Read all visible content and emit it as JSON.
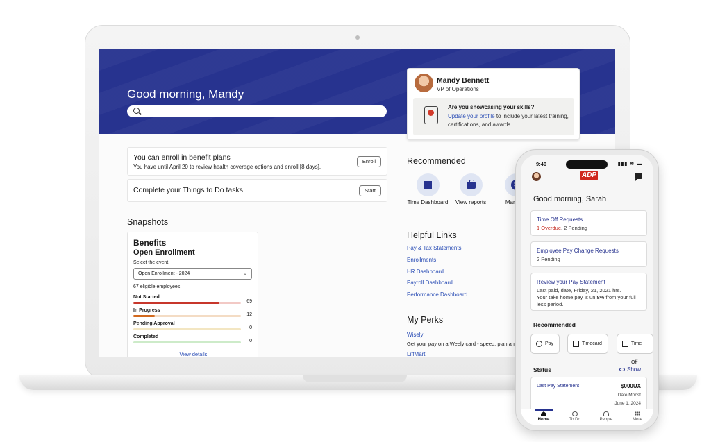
{
  "desktop": {
    "greeting": "Good morning, Mandy",
    "search": {
      "placeholder": ""
    },
    "profile": {
      "name": "Mandy Bennett",
      "title": "VP of Operations",
      "skills_question": "Are you showcasing your skills?",
      "skills_link": "Update your profile",
      "skills_text": " to include your latest training, certifications, and awards."
    },
    "enroll": {
      "title": "You can enroll in benefit plans",
      "subtitle": "You have until April 20 to review health coverage options and enroll [8 days].",
      "button": "Enroll"
    },
    "todo": {
      "title": "Complete your Things to Do tasks",
      "button": "Start"
    },
    "snapshots": {
      "heading": "Snapshots",
      "benefits": {
        "title": "Benefits",
        "subtitle": "Open Enrollment",
        "select_label": "Select the event.",
        "select_value": "Open Enrollment - 2024",
        "eligible": "67 eligible employees",
        "rows": [
          {
            "label": "Not Started",
            "count": "69",
            "fraction": 0.8,
            "color": "#c7362b",
            "track": "#f2c9c5"
          },
          {
            "label": "In Progress",
            "count": "12",
            "fraction": 0.2,
            "color": "#d2691e",
            "track": "#f4dcc4"
          },
          {
            "label": "Pending Approval",
            "count": "0",
            "fraction": 0,
            "color": "#e8c777",
            "track": "#f3e6c2"
          },
          {
            "label": "Completed",
            "count": "0",
            "fraction": 0,
            "color": "#8fd18f",
            "track": "#cdebc9"
          }
        ],
        "view_details": "View details"
      }
    },
    "recommended": {
      "heading": "Recommended",
      "items": [
        {
          "label": "Time Dashboard",
          "icon": "grid-icon"
        },
        {
          "label": "View reports",
          "icon": "briefcase-icon"
        },
        {
          "label": "Man Insi",
          "icon": "dollar-icon"
        }
      ]
    },
    "helpful_links": {
      "heading": "Helpful Links",
      "links": [
        "Pay & Tax Statements",
        "Enrollments",
        "HR Dashboard",
        "Payroll Dashboard",
        "Performance Dashboard"
      ]
    },
    "perks": {
      "heading": "My Perks",
      "items": [
        {
          "name": "Wisely",
          "desc": "Get your pay on a Weely card - speed, plan and"
        },
        {
          "name": "LiffMart",
          "desc": ""
        }
      ]
    }
  },
  "mobile": {
    "time": "9:40",
    "status_icons": "▮▮▮ ≋ ▬",
    "logo": "ADP",
    "greeting": "Good morning, Sarah",
    "cards": [
      {
        "title": "Time Off Requests",
        "overdue": "1 Overdue",
        "rest": ", 2 Pending"
      },
      {
        "title": "Employee Pay Change Requests",
        "sub": "2 Pending"
      },
      {
        "title": "Review your Pay Statement",
        "line1": "Last paid, date, Friday, 21, 2021 hrs.",
        "line2a": "Your take home pay is un ",
        "line2b": "8%",
        "line2c": " from your full less period."
      }
    ],
    "recommended_heading": "Recommended",
    "chips": [
      "Pay",
      "Timecard",
      "Time Off"
    ],
    "status_heading": "Status",
    "show_label": "Show",
    "pay": {
      "label": "Last Pay Statement",
      "amount": "$000UX",
      "date1": "Date Monst",
      "date2": "June 1, 2024"
    },
    "nav": [
      "Home",
      "To Do",
      "People",
      "More"
    ]
  },
  "colors": {
    "brand_blue": "#27338f",
    "adp_red": "#d0271d",
    "link": "#2a4db5"
  }
}
